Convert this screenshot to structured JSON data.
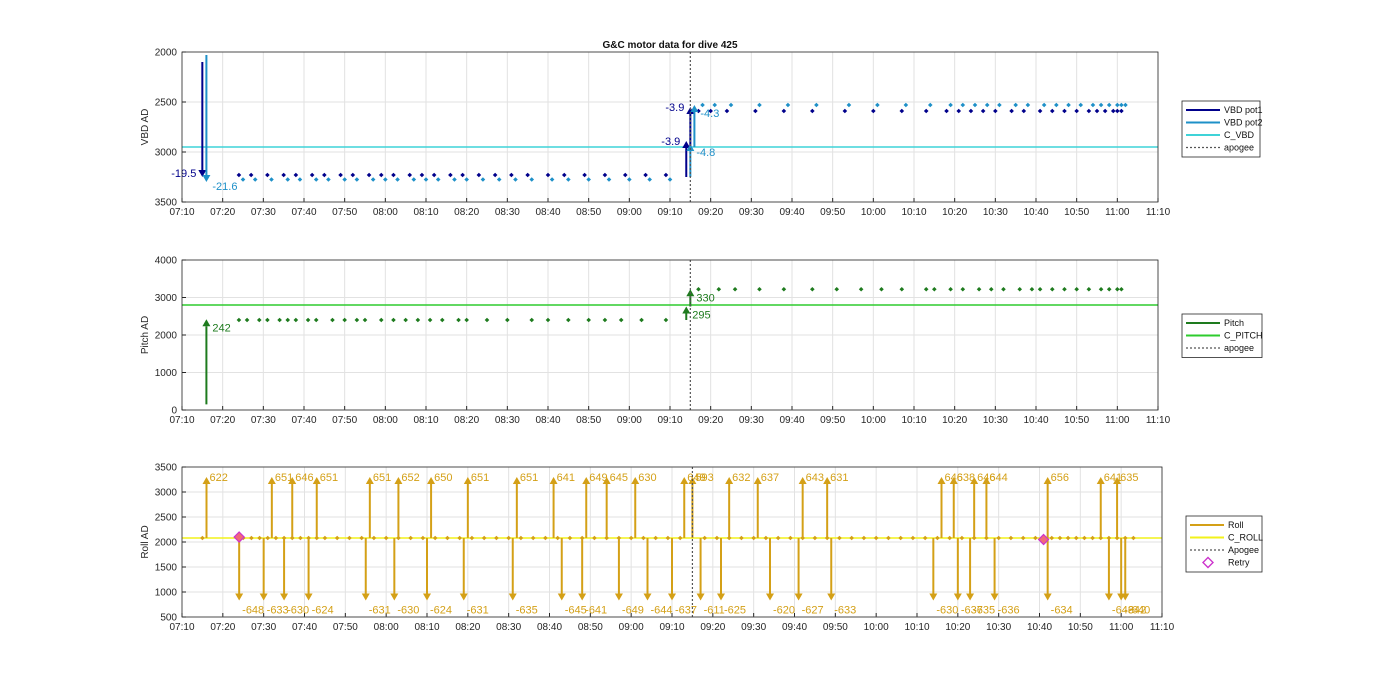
{
  "figure_title": "G&C motor data for dive 425",
  "colors": {
    "vbd_pot1": "#00008B",
    "vbd_pot2": "#1E90C8",
    "c_vbd": "#3FD3D8",
    "pitch": "#1E7B1E",
    "c_pitch": "#2ECC2E",
    "roll": "#D4A017",
    "c_roll": "#F2F21A",
    "apogee": "#555555",
    "retry": "#CC33CC",
    "grid": "#E2E2E2",
    "axis": "#262626"
  },
  "x_ticks": [
    "07:10",
    "07:20",
    "07:30",
    "07:40",
    "07:50",
    "08:00",
    "08:10",
    "08:20",
    "08:30",
    "08:40",
    "08:50",
    "09:00",
    "09:10",
    "09:20",
    "09:30",
    "09:40",
    "09:50",
    "10:00",
    "10:10",
    "10:20",
    "10:30",
    "10:40",
    "10:50",
    "11:00",
    "11:10"
  ],
  "chart_data": [
    {
      "type": "line",
      "title": "G&C motor data for dive 425",
      "xlabel": "",
      "ylabel": "VBD AD",
      "xlim": [
        "07:10",
        "11:10"
      ],
      "ylim": [
        3500,
        2000
      ],
      "y_reversed": true,
      "yticks": [
        "2000",
        "2500",
        "3000",
        "3500"
      ],
      "grid": true,
      "legend_position": "outside-right",
      "legend": [
        "VBD pot1",
        "VBD pot2",
        "C_VBD",
        "apogee"
      ],
      "apogee_time": "09:15",
      "reference_lines": [
        {
          "name": "C_VBD",
          "value": 2950
        }
      ],
      "moves": [
        {
          "series": "VBD pot1",
          "time": "07:15",
          "from": 2100,
          "to": 3250,
          "label": "-19.5"
        },
        {
          "series": "VBD pot2",
          "time": "07:16",
          "from": 2030,
          "to": 3300,
          "label": "-21.6"
        },
        {
          "series": "VBD pot1",
          "time": "09:14",
          "from": 3250,
          "to": 2890,
          "label": "-3.9"
        },
        {
          "series": "VBD pot2",
          "time": "09:15",
          "from": 3250,
          "to": 2920,
          "label": "-4.8"
        },
        {
          "series": "VBD pot1",
          "time": "09:15",
          "from": 2940,
          "to": 2550,
          "label": "-3.9"
        },
        {
          "series": "VBD pot2",
          "time": "09:16",
          "from": 2950,
          "to": 2530,
          "label": "-4.3"
        }
      ],
      "series": [
        {
          "name": "VBD pot1",
          "y_before": 3230,
          "y_after": 2590,
          "times": [
            "07:24",
            "07:27",
            "07:31",
            "07:35",
            "07:38",
            "07:42",
            "07:45",
            "07:49",
            "07:52",
            "07:56",
            "07:59",
            "08:02",
            "08:06",
            "08:09",
            "08:12",
            "08:16",
            "08:19",
            "08:23",
            "08:27",
            "08:31",
            "08:35",
            "08:40",
            "08:44",
            "08:49",
            "08:54",
            "08:59",
            "09:04",
            "09:09",
            "09:17",
            "09:20",
            "09:24",
            "09:31",
            "09:38",
            "09:45",
            "09:53",
            "10:00",
            "10:07",
            "10:13",
            "10:18",
            "10:21",
            "10:24",
            "10:27",
            "10:30",
            "10:34",
            "10:37",
            "10:41",
            "10:44",
            "10:47",
            "10:50",
            "10:53",
            "10:55",
            "10:57",
            "10:59",
            "11:00",
            "11:01"
          ]
        },
        {
          "name": "VBD pot2",
          "y_before": 3275,
          "y_after": 2530,
          "times": [
            "07:25",
            "07:28",
            "07:32",
            "07:36",
            "07:39",
            "07:43",
            "07:46",
            "07:50",
            "07:53",
            "07:57",
            "08:00",
            "08:03",
            "08:07",
            "08:10",
            "08:13",
            "08:17",
            "08:20",
            "08:24",
            "08:28",
            "08:32",
            "08:36",
            "08:41",
            "08:45",
            "08:50",
            "08:55",
            "09:00",
            "09:05",
            "09:10",
            "09:18",
            "09:21",
            "09:25",
            "09:32",
            "09:39",
            "09:46",
            "09:54",
            "10:01",
            "10:08",
            "10:14",
            "10:19",
            "10:22",
            "10:25",
            "10:28",
            "10:31",
            "10:35",
            "10:38",
            "10:42",
            "10:45",
            "10:48",
            "10:51",
            "10:54",
            "10:56",
            "10:58",
            "11:00",
            "11:01",
            "11:02"
          ]
        }
      ]
    },
    {
      "type": "line",
      "title": "",
      "xlabel": "",
      "ylabel": "Pitch AD",
      "xlim": [
        "07:10",
        "11:10"
      ],
      "ylim": [
        0,
        4000
      ],
      "yticks": [
        "0",
        "1000",
        "2000",
        "3000",
        "4000"
      ],
      "grid": true,
      "legend_position": "outside-right",
      "legend": [
        "Pitch",
        "C_PITCH",
        "apogee"
      ],
      "apogee_time": "09:15",
      "reference_lines": [
        {
          "name": "C_PITCH",
          "value": 2800
        }
      ],
      "moves": [
        {
          "series": "Pitch",
          "time": "07:16",
          "from": 150,
          "to": 2420,
          "label": "242"
        },
        {
          "series": "Pitch",
          "time": "09:14",
          "from": 2400,
          "to": 2760,
          "label": "295"
        },
        {
          "series": "Pitch",
          "time": "09:15",
          "from": 2760,
          "to": 3220,
          "label": "330"
        }
      ],
      "series": [
        {
          "name": "Pitch",
          "y_before": 2400,
          "y_after": 3220,
          "times": [
            "07:24",
            "07:26",
            "07:29",
            "07:31",
            "07:34",
            "07:36",
            "07:38",
            "07:41",
            "07:43",
            "07:47",
            "07:50",
            "07:53",
            "07:55",
            "07:59",
            "08:02",
            "08:05",
            "08:08",
            "08:11",
            "08:14",
            "08:18",
            "08:20",
            "08:25",
            "08:30",
            "08:36",
            "08:40",
            "08:45",
            "08:50",
            "08:54",
            "08:58",
            "09:03",
            "09:09",
            "09:17",
            "09:22",
            "09:26",
            "09:32",
            "09:38",
            "09:45",
            "09:51",
            "09:57",
            "10:02",
            "10:07",
            "10:13",
            "10:15",
            "10:19",
            "10:22",
            "10:26",
            "10:29",
            "10:32",
            "10:36",
            "10:39",
            "10:41",
            "10:44",
            "10:47",
            "10:50",
            "10:53",
            "10:56",
            "10:58",
            "11:00",
            "11:01"
          ]
        }
      ]
    },
    {
      "type": "line",
      "title": "",
      "xlabel": "",
      "ylabel": "Roll AD",
      "xlim": [
        "07:10",
        "11:10"
      ],
      "ylim": [
        500,
        3500
      ],
      "yticks": [
        "500",
        "1000",
        "1500",
        "2000",
        "2500",
        "3000",
        "3500"
      ],
      "grid": true,
      "legend_position": "outside-right",
      "legend": [
        "Roll",
        "C_ROLL",
        "Apogee",
        "Retry"
      ],
      "apogee_time": "09:15",
      "reference_lines": [
        {
          "name": "C_ROLL",
          "value": 2080
        }
      ],
      "series": [
        {
          "name": "Roll",
          "y": 2080,
          "times": [
            "07:15",
            "07:25",
            "07:27",
            "07:29",
            "07:31",
            "07:33",
            "07:35",
            "07:37",
            "07:39",
            "07:41",
            "07:43",
            "07:45",
            "07:48",
            "07:51",
            "07:54",
            "07:57",
            "08:00",
            "08:03",
            "08:06",
            "08:09",
            "08:12",
            "08:15",
            "08:18",
            "08:21",
            "08:24",
            "08:27",
            "08:30",
            "08:33",
            "08:36",
            "08:39",
            "08:42",
            "08:45",
            "08:48",
            "08:51",
            "08:54",
            "08:57",
            "09:00",
            "09:03",
            "09:06",
            "09:09",
            "09:12",
            "09:18",
            "09:21",
            "09:24",
            "09:27",
            "09:30",
            "09:33",
            "09:36",
            "09:39",
            "09:42",
            "09:45",
            "09:48",
            "09:51",
            "09:54",
            "09:57",
            "10:00",
            "10:03",
            "10:06",
            "10:09",
            "10:12",
            "10:15",
            "10:18",
            "10:21",
            "10:24",
            "10:27",
            "10:30",
            "10:33",
            "10:36",
            "10:39",
            "10:43",
            "10:45",
            "10:47",
            "10:49",
            "10:51",
            "10:53",
            "10:55",
            "10:57",
            "10:59",
            "11:01",
            "11:03"
          ]
        }
      ],
      "retry_points": [
        {
          "time": "07:24",
          "value": 2100
        },
        {
          "time": "10:41",
          "value": 2050
        }
      ],
      "events": [
        {
          "t_out": "07:16",
          "out": "622",
          "t_back": "07:24",
          "back": "-648"
        },
        {
          "t_out": "07:32",
          "out": "651",
          "t_back": "07:30",
          "back": "-633"
        },
        {
          "t_out": "07:37",
          "out": "646",
          "t_back": "07:35",
          "back": "-630"
        },
        {
          "t_out": "07:43",
          "out": "651",
          "t_back": "07:41",
          "back": "-624"
        },
        {
          "t_out": "07:56",
          "out": "651",
          "t_back": "07:55",
          "back": "-631"
        },
        {
          "t_out": "08:03",
          "out": "652",
          "t_back": "08:02",
          "back": "-630"
        },
        {
          "t_out": "08:11",
          "out": "650",
          "t_back": "08:10",
          "back": "-624"
        },
        {
          "t_out": "08:20",
          "out": "651",
          "t_back": "08:19",
          "back": "-631"
        },
        {
          "t_out": "08:32",
          "out": "651",
          "t_back": "08:31",
          "back": "-635"
        },
        {
          "t_out": "08:41",
          "out": "641",
          "t_back": "08:43",
          "back": "-645"
        },
        {
          "t_out": "08:49",
          "out": "649",
          "t_back": "08:48",
          "back": "-641"
        },
        {
          "t_out": "08:54",
          "out": "645",
          "t_back": "08:57",
          "back": "-649"
        },
        {
          "t_out": "09:01",
          "out": "630",
          "t_back": "09:04",
          "back": "-644"
        },
        {
          "t_out": "09:13",
          "out": "649",
          "t_back": "09:10",
          "back": "-637"
        },
        {
          "t_out": "09:15",
          "out": "593",
          "t_back": "09:17",
          "back": "-611"
        },
        {
          "t_out": "09:24",
          "out": "632",
          "t_back": "09:22",
          "back": "-625"
        },
        {
          "t_out": "09:31",
          "out": "637",
          "t_back": "09:34",
          "back": "-620"
        },
        {
          "t_out": "09:42",
          "out": "643",
          "t_back": "09:41",
          "back": "-627"
        },
        {
          "t_out": "09:48",
          "out": "631",
          "t_back": "09:49",
          "back": "-633"
        },
        {
          "t_out": "10:16",
          "out": "646",
          "t_back": "10:14",
          "back": "-630"
        },
        {
          "t_out": "10:19",
          "out": "638",
          "t_back": "10:20",
          "back": "-637"
        },
        {
          "t_out": "10:24",
          "out": "646",
          "t_back": "10:23",
          "back": "-635"
        },
        {
          "t_out": "10:27",
          "out": "644",
          "t_back": "10:29",
          "back": "-636"
        },
        {
          "t_out": "10:42",
          "out": "656",
          "t_back": "10:42",
          "back": "-634"
        },
        {
          "t_out": "10:55",
          "out": "641",
          "t_back": "10:57",
          "back": "-643"
        },
        {
          "t_out": "10:59",
          "out": "635",
          "t_back": "11:01",
          "back": "-640"
        },
        {
          "t_out": "11:00",
          "out": "",
          "t_back": "11:00",
          "back": "-642"
        }
      ]
    }
  ]
}
